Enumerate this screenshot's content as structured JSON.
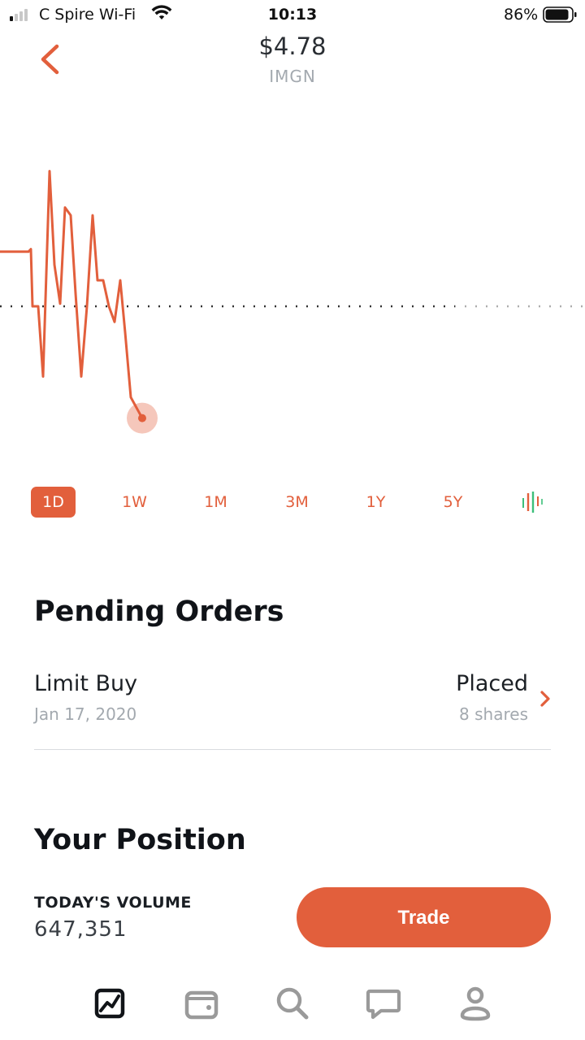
{
  "status_bar": {
    "carrier": "C Spire Wi-Fi",
    "time": "10:13",
    "battery": "86%"
  },
  "header": {
    "price": "$4.78",
    "ticker": "IMGN"
  },
  "colors": {
    "accent": "#e25f3c",
    "muted_text": "#a3a9af",
    "heading": "#101318",
    "nav_active": "#111418",
    "nav_inactive": "#9a9a9a"
  },
  "chart_data": {
    "type": "line",
    "series_shape": [
      0.39,
      0.39,
      0.39,
      0.38,
      0.6,
      0.6,
      0.87,
      0.08,
      0.44,
      0.59,
      0.22,
      0.25,
      0.55,
      0.87,
      0.6,
      0.25,
      0.5,
      0.5,
      0.6,
      0.66,
      0.5,
      0.7,
      0.95,
      1.03
    ],
    "reference_line": 0.6,
    "note_units": "relative (no axis printed)"
  },
  "range_tabs": [
    {
      "label": "1D",
      "active": true
    },
    {
      "label": "1W",
      "active": false
    },
    {
      "label": "1M",
      "active": false
    },
    {
      "label": "3M",
      "active": false
    },
    {
      "label": "1Y",
      "active": false
    },
    {
      "label": "5Y",
      "active": false
    }
  ],
  "candlestick_toggle_icon": "candlestick-icon",
  "pending_orders": {
    "title": "Pending Orders",
    "orders": [
      {
        "type": "Limit Buy",
        "date": "Jan 17, 2020",
        "status": "Placed",
        "shares": "8 shares"
      }
    ]
  },
  "position": {
    "title": "Your Position",
    "volume_label": "TODAY'S VOLUME",
    "volume_value": "647,351"
  },
  "trade_button": {
    "label": "Trade"
  },
  "bottom_nav": [
    {
      "icon": "chart-icon",
      "active": true
    },
    {
      "icon": "wallet-icon",
      "active": false
    },
    {
      "icon": "search-icon",
      "active": false
    },
    {
      "icon": "chat-icon",
      "active": false
    },
    {
      "icon": "profile-icon",
      "active": false
    }
  ]
}
